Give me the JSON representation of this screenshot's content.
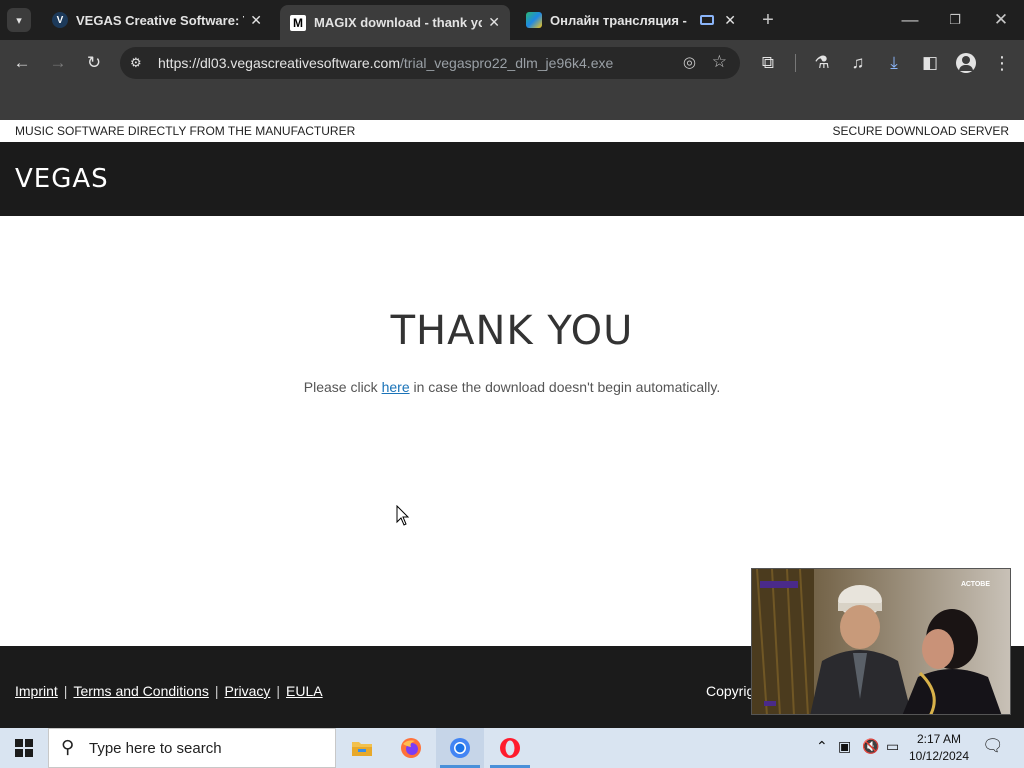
{
  "browser": {
    "tabs": [
      {
        "title": "VEGAS Creative Software: The",
        "favicon": "V",
        "active": false
      },
      {
        "title": "MAGIX download - thank you",
        "favicon": "M",
        "active": true
      },
      {
        "title": "Онлайн трансляция - «АС",
        "favicon": "stream",
        "active": false
      }
    ],
    "url_host": "https://dl03.vegascreativesoftware.com",
    "url_path": "/trial_vegaspro22_dlm_je96k4.exe"
  },
  "page": {
    "top_left": "MUSIC SOFTWARE DIRECTLY FROM THE MANUFACTURER",
    "top_right": "SECURE DOWNLOAD SERVER",
    "logo": "VEGAS",
    "heading": "THANK YOU",
    "para_before": "Please click ",
    "para_link": "here",
    "para_after": " in case the download doesn't begin automatically.",
    "footer": {
      "links": [
        "Imprint",
        "Terms and Conditions",
        "Privacy",
        "EULA"
      ],
      "copyright": "Copyrig"
    }
  },
  "pip": {
    "channel_tag": "АСТОВЕ"
  },
  "taskbar": {
    "search_placeholder": "Type here to search",
    "time": "2:17 AM",
    "date": "10/12/2024"
  }
}
